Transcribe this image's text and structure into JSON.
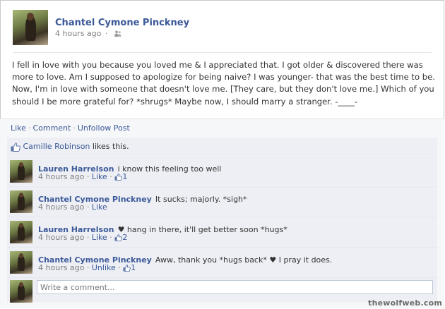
{
  "post": {
    "author": "Chantel Cymone Pinckney",
    "time": "4 hours ago",
    "privacy_icon": "friends-icon",
    "text": "I fell in love with you because you loved me & I appreciated that. I got older & discovered there was more to love. Am I supposed to apologize for being naive? I was younger- that was the best time to be. Now, I'm in love with someone that doesn't love me. [They care, but they don't love me.] Which of you should I be more grateful for? *shrugs* Maybe now, I should marry a stranger. -____-"
  },
  "actions": {
    "like": "Like",
    "comment": "Comment",
    "unfollow": "Unfollow Post"
  },
  "likes": {
    "name": "Camille Robinson",
    "suffix": "likes this."
  },
  "comments": [
    {
      "name": "Lauren Harrelson",
      "text": "i know this feeling too well",
      "time": "4 hours ago",
      "action": "Like",
      "like_count": "1"
    },
    {
      "name": "Chantel Cymone Pinckney",
      "text": "It sucks; majorly. *sigh*",
      "time": "4 hours ago",
      "action": "Like",
      "like_count": ""
    },
    {
      "name": "Lauren Harrelson",
      "text": "♥ hang in there, it'll get better soon *hugs*",
      "time": "4 hours ago",
      "action": "Like",
      "like_count": "2"
    },
    {
      "name": "Chantel Cymone Pinckney",
      "text": "Aww, thank you *hugs back* ♥ I pray it does.",
      "time": "4 hours ago",
      "action": "Unlike",
      "like_count": "1"
    }
  ],
  "composer": {
    "placeholder": "Write a comment..."
  },
  "watermark": "thewolfweb.com",
  "colors": {
    "link": "#3b5998",
    "panel": "#edeff4",
    "muted": "#808080"
  }
}
